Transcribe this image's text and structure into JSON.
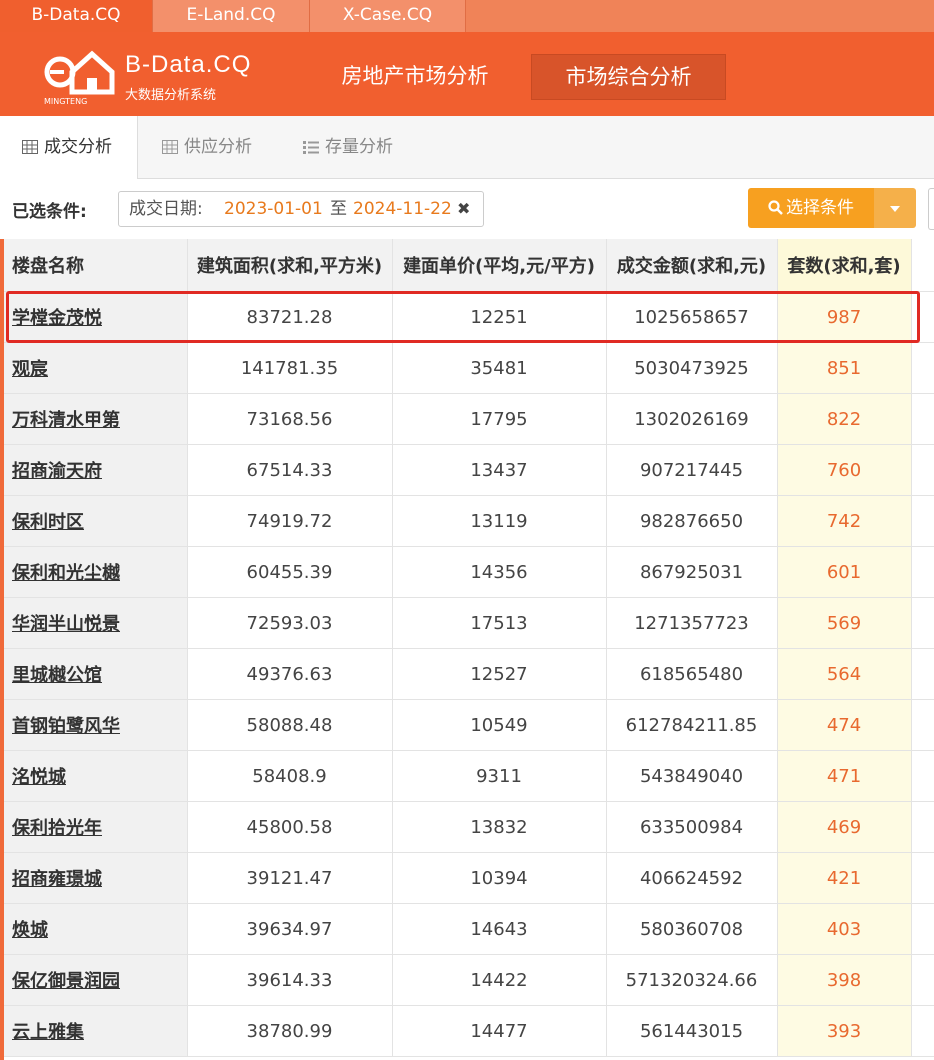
{
  "app_tabs": [
    "B-Data.CQ",
    "E-Land.CQ",
    "X-Case.CQ"
  ],
  "brand": {
    "title": "B-Data.CQ",
    "subtitle": "大数据分析系统",
    "logo_text": "MINGTENG"
  },
  "nav": [
    "房地产市场分析",
    "市场综合分析"
  ],
  "subtabs": [
    "成交分析",
    "供应分析",
    "存量分析"
  ],
  "filter": {
    "label": "已选条件:",
    "chip_key": "成交日期:",
    "start": "2023-01-01",
    "sep": "至",
    "end": "2024-11-22",
    "select_button": "选择条件"
  },
  "colors": {
    "primary": "#f15f2f",
    "orange_value": "#e87a1d",
    "button": "#f7a020",
    "highlight": "#e02a23"
  },
  "table": {
    "headers": [
      "楼盘名称",
      "建筑面积(求和,平方米)",
      "建面单价(平均,元/平方)",
      "成交金额(求和,元)",
      "套数(求和,套)"
    ],
    "rows": [
      [
        "学樘金茂悦",
        "83721.28",
        "12251",
        "1025658657",
        "987"
      ],
      [
        "观宸",
        "141781.35",
        "35481",
        "5030473925",
        "851"
      ],
      [
        "万科清水甲第",
        "73168.56",
        "17795",
        "1302026169",
        "822"
      ],
      [
        "招商渝天府",
        "67514.33",
        "13437",
        "907217445",
        "760"
      ],
      [
        "保利时区",
        "74919.72",
        "13119",
        "982876650",
        "742"
      ],
      [
        "保利和光尘樾",
        "60455.39",
        "14356",
        "867925031",
        "601"
      ],
      [
        "华润半山悦景",
        "72593.03",
        "17513",
        "1271357723",
        "569"
      ],
      [
        "里城樾公馆",
        "49376.63",
        "12527",
        "618565480",
        "564"
      ],
      [
        "首钢铂鹭风华",
        "58088.48",
        "10549",
        "612784211.85",
        "474"
      ],
      [
        "洺悦城",
        "58408.9",
        "9311",
        "543849040",
        "471"
      ],
      [
        "保利拾光年",
        "45800.58",
        "13832",
        "633500984",
        "469"
      ],
      [
        "招商雍璟城",
        "39121.47",
        "10394",
        "406624592",
        "421"
      ],
      [
        "焕城",
        "39634.97",
        "14643",
        "580360708",
        "403"
      ],
      [
        "保亿御景润园",
        "39614.33",
        "14422",
        "571320324.66",
        "398"
      ],
      [
        "云上雅集",
        "38780.99",
        "14477",
        "561443015",
        "393"
      ]
    ]
  }
}
